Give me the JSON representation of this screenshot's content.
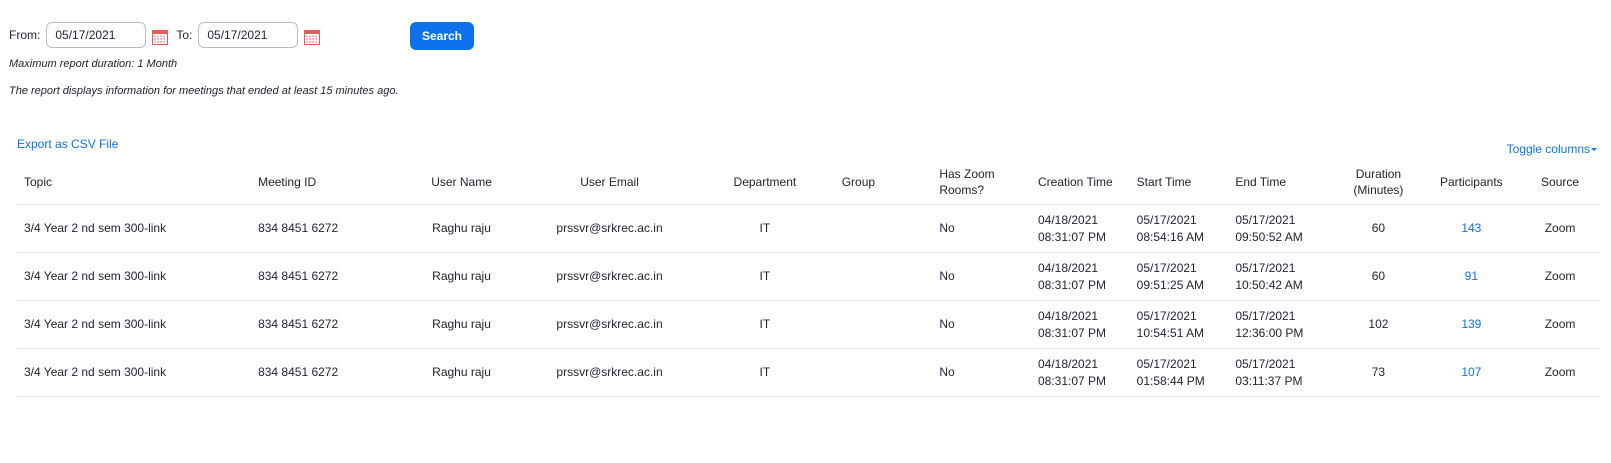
{
  "filter": {
    "from_label": "From:",
    "from_value": "05/17/2021",
    "to_label": "To:",
    "to_value": "05/17/2021",
    "search_label": "Search",
    "calendar_icon": "calendar-icon",
    "calendar_color": "#e55a5a"
  },
  "notes": {
    "max_duration": "Maximum report duration: 1 Month",
    "info": "The report displays information for meetings that ended at least 15 minutes ago."
  },
  "actions": {
    "export_label": "Export as CSV File",
    "toggle_label": "Toggle columns"
  },
  "colors": {
    "accent": "#0e72ed",
    "text": "#232333",
    "border": "#e6e6ea"
  },
  "table": {
    "headers": {
      "topic": "Topic",
      "meeting_id": "Meeting ID",
      "user_name": "User Name",
      "user_email": "User Email",
      "department": "Department",
      "group": "Group",
      "has_zoom_rooms_1": "Has Zoom",
      "has_zoom_rooms_2": "Rooms?",
      "creation_time": "Creation Time",
      "start_time": "Start Time",
      "end_time": "End Time",
      "duration_1": "Duration",
      "duration_2": "(Minutes)",
      "participants": "Participants",
      "source": "Source"
    },
    "rows": [
      {
        "topic": "3/4 Year 2 nd sem 300-link",
        "meeting_id": "834 8451 6272",
        "user_name": "Raghu raju",
        "user_email": "prssvr@srkrec.ac.in",
        "department": "IT",
        "group": "",
        "has_zoom_rooms": "No",
        "creation_date": "04/18/2021",
        "creation_clock": "08:31:07 PM",
        "start_date": "05/17/2021",
        "start_clock": "08:54:16 AM",
        "end_date": "05/17/2021",
        "end_clock": "09:50:52 AM",
        "duration": "60",
        "participants": "143",
        "source": "Zoom"
      },
      {
        "topic": "3/4 Year 2 nd sem 300-link",
        "meeting_id": "834 8451 6272",
        "user_name": "Raghu raju",
        "user_email": "prssvr@srkrec.ac.in",
        "department": "IT",
        "group": "",
        "has_zoom_rooms": "No",
        "creation_date": "04/18/2021",
        "creation_clock": "08:31:07 PM",
        "start_date": "05/17/2021",
        "start_clock": "09:51:25 AM",
        "end_date": "05/17/2021",
        "end_clock": "10:50:42 AM",
        "duration": "60",
        "participants": "91",
        "source": "Zoom"
      },
      {
        "topic": "3/4 Year 2 nd sem 300-link",
        "meeting_id": "834 8451 6272",
        "user_name": "Raghu raju",
        "user_email": "prssvr@srkrec.ac.in",
        "department": "IT",
        "group": "",
        "has_zoom_rooms": "No",
        "creation_date": "04/18/2021",
        "creation_clock": "08:31:07 PM",
        "start_date": "05/17/2021",
        "start_clock": "10:54:51 AM",
        "end_date": "05/17/2021",
        "end_clock": "12:36:00 PM",
        "duration": "102",
        "participants": "139",
        "source": "Zoom"
      },
      {
        "topic": "3/4 Year 2 nd sem 300-link",
        "meeting_id": "834 8451 6272",
        "user_name": "Raghu raju",
        "user_email": "prssvr@srkrec.ac.in",
        "department": "IT",
        "group": "",
        "has_zoom_rooms": "No",
        "creation_date": "04/18/2021",
        "creation_clock": "08:31:07 PM",
        "start_date": "05/17/2021",
        "start_clock": "01:58:44 PM",
        "end_date": "05/17/2021",
        "end_clock": "03:11:37 PM",
        "duration": "73",
        "participants": "107",
        "source": "Zoom"
      }
    ]
  }
}
